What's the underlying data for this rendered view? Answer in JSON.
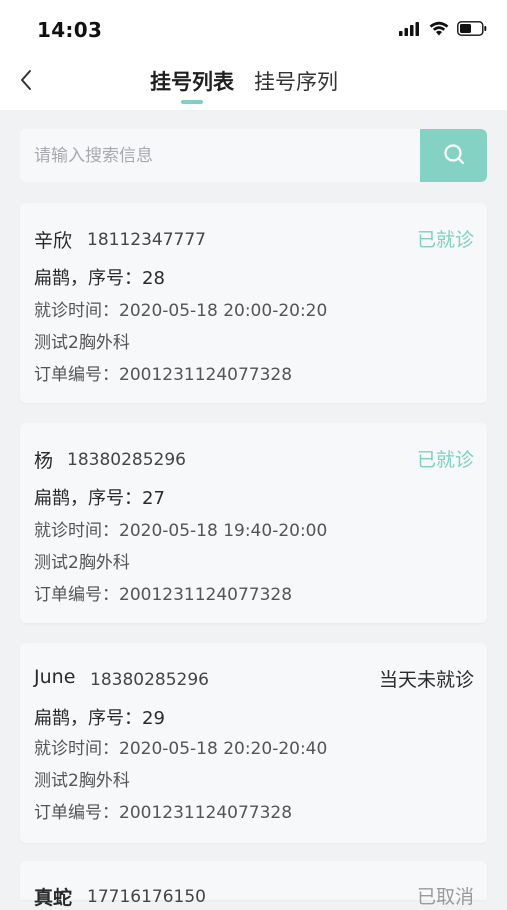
{
  "status_bar": {
    "time": "14:03"
  },
  "nav": {
    "tabs": [
      {
        "label": "挂号列表",
        "active": true
      },
      {
        "label": "挂号序列",
        "active": false
      }
    ]
  },
  "search": {
    "placeholder": "请输入搜索信息",
    "value": ""
  },
  "colors": {
    "accent": "#84d2c3",
    "status_visited": "#7fd0c2",
    "status_not_visited": "#2b2b2b",
    "status_cancelled": "#9a9a9a"
  },
  "registrations": [
    {
      "name": "辛欣",
      "phone": "18112347777",
      "status": "已就诊",
      "doctor_seq": "扁鹊，序号：28",
      "visit_time": "就诊时间：2020-05-18 20:00-20:20",
      "department": "测试2胸外科",
      "order_no": "订单编号：2001231124077328"
    },
    {
      "name": "杨",
      "phone": "18380285296",
      "status": "已就诊",
      "doctor_seq": "扁鹊，序号：27",
      "visit_time": "就诊时间：2020-05-18 19:40-20:00",
      "department": "测试2胸外科",
      "order_no": "订单编号：2001231124077328"
    },
    {
      "name": "June",
      "phone": "18380285296",
      "status": "当天未就诊",
      "doctor_seq": "扁鹊，序号：29",
      "visit_time": "就诊时间：2020-05-18 20:20-20:40",
      "department": "测试2胸外科",
      "order_no": "订单编号：2001231124077328"
    },
    {
      "name": "真蛇",
      "phone": "17716176150",
      "status": "已取消"
    }
  ]
}
